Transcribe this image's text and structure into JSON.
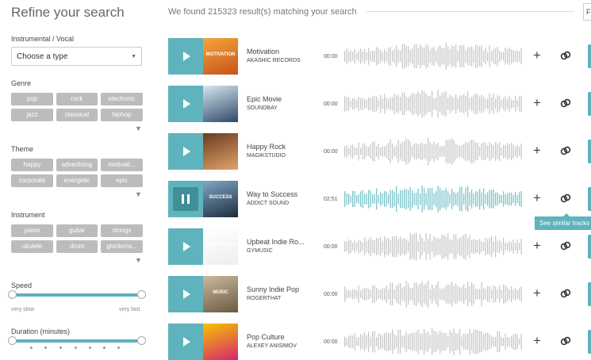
{
  "sidebar": {
    "title": "Refine your search",
    "instrumental_label": "Instrumental / Vocal",
    "select_value": "Choose a type",
    "genre_label": "Genre",
    "genres": [
      "pop",
      "rock",
      "electronic",
      "jazz",
      "classical",
      "hiphop"
    ],
    "theme_label": "Theme",
    "themes": [
      "happy",
      "advertising",
      "motivati...",
      "corporate",
      "energetic",
      "epic"
    ],
    "instrument_label": "Instrument",
    "instruments": [
      "piano",
      "guitar",
      "strings",
      "ukulele",
      "drum",
      "glockens..."
    ],
    "speed_label": "Speed",
    "speed_min": "very slow",
    "speed_max": "very fast",
    "duration_label": "Duration (minutes)"
  },
  "results": {
    "summary": "We found 215323 result(s) matching your search",
    "filter_box": "F"
  },
  "tracks": [
    {
      "title": "Motivation",
      "artist": "AKASHIC RECORDS",
      "time": "00:00",
      "playing": false,
      "cover_text": "MOTIVATION",
      "cover_colors": [
        "#f4a63a",
        "#c9521b"
      ]
    },
    {
      "title": "Epic Movie",
      "artist": "SOUNDBAY",
      "time": "00:00",
      "playing": false,
      "cover_text": "",
      "cover_colors": [
        "#d8e6ef",
        "#2d4a6b"
      ]
    },
    {
      "title": "Happy Rock",
      "artist": "MAGIKSTUDIO",
      "time": "00:00",
      "playing": false,
      "cover_text": "",
      "cover_colors": [
        "#6b3a1f",
        "#e0a46c"
      ]
    },
    {
      "title": "Way to Success",
      "artist": "ADDICT SOUND",
      "time": "02:51",
      "playing": true,
      "cover_text": "SUCCESS",
      "cover_colors": [
        "#7fa6c9",
        "#1f2d3a"
      ]
    },
    {
      "title": "Upbeat Indie Ro...",
      "artist": "GYMUSIC",
      "time": "00:00",
      "playing": false,
      "cover_text": "GOOD VIBES",
      "cover_colors": [
        "#ffffff",
        "#eeeeee"
      ]
    },
    {
      "title": "Sunny Indie Pop",
      "artist": "ROGERTHAT",
      "time": "00:00",
      "playing": false,
      "cover_text": "MUSIC",
      "cover_colors": [
        "#c9b99d",
        "#6b5a40"
      ]
    },
    {
      "title": "Pop Culture",
      "artist": "ALEXEY ANISIMOV",
      "time": "00:00",
      "playing": false,
      "cover_text": "",
      "cover_colors": [
        "#f5c400",
        "#d6246e"
      ]
    }
  ],
  "tooltip": "See similar tracks",
  "colors": {
    "accent": "#5fb3bc",
    "wave_gray": "#c8c8c8",
    "wave_active": "#7cc4cb"
  }
}
